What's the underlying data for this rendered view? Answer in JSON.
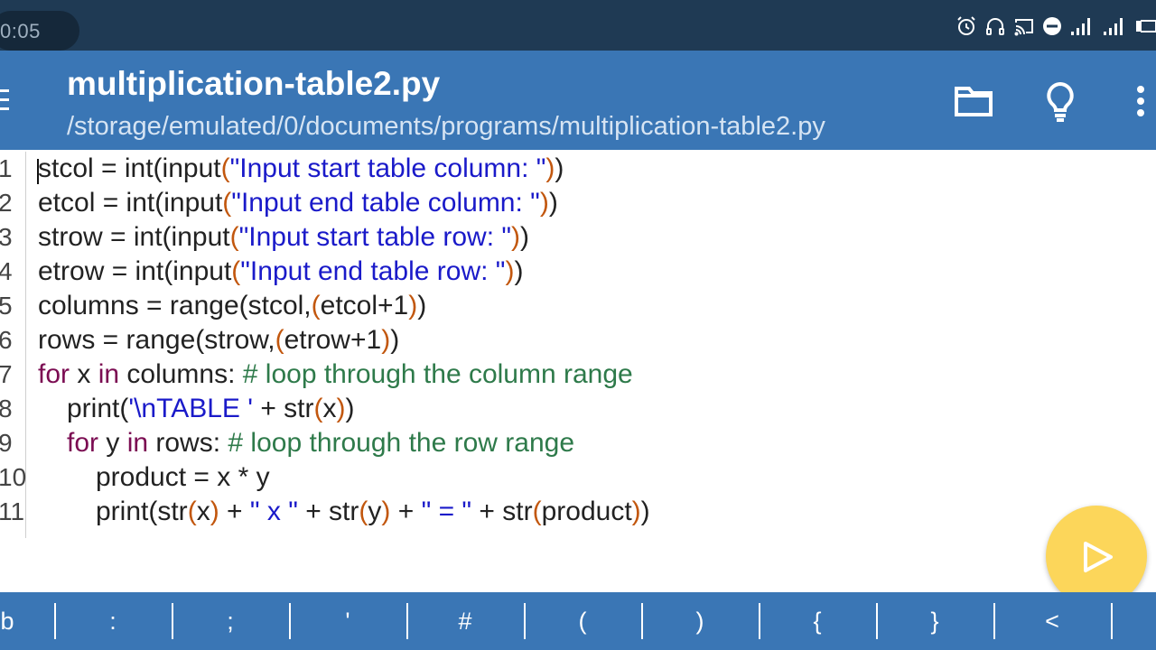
{
  "status_bar": {
    "time": "0:05",
    "icons": [
      "alarm-icon",
      "headphones-icon",
      "cast-icon",
      "dnd-icon",
      "signal-icon",
      "signal-icon",
      "battery-icon"
    ]
  },
  "app_bar": {
    "title": "multiplication-table2.py",
    "path": "/storage/emulated/0/documents/programs/multiplication-table2.py",
    "icons": [
      "menu-icon",
      "folder-icon",
      "lightbulb-icon",
      "more-vert-icon"
    ]
  },
  "editor": {
    "lines": [
      {
        "num": "1",
        "indent": 0,
        "tokens": [
          [
            "t",
            "stcol = int(input"
          ],
          [
            "p",
            "("
          ],
          [
            "s",
            "\"Input start table column: \""
          ],
          [
            "p",
            ")"
          ],
          [
            "t",
            ")"
          ]
        ]
      },
      {
        "num": "2",
        "indent": 0,
        "tokens": [
          [
            "t",
            "etcol = int(input"
          ],
          [
            "p",
            "("
          ],
          [
            "s",
            "\"Input end table column: \""
          ],
          [
            "p",
            ")"
          ],
          [
            "t",
            ")"
          ]
        ]
      },
      {
        "num": "3",
        "indent": 0,
        "tokens": [
          [
            "t",
            "strow = int(input"
          ],
          [
            "p",
            "("
          ],
          [
            "s",
            "\"Input start table row: \""
          ],
          [
            "p",
            ")"
          ],
          [
            "t",
            ")"
          ]
        ]
      },
      {
        "num": "4",
        "indent": 0,
        "tokens": [
          [
            "t",
            "etrow = int(input"
          ],
          [
            "p",
            "("
          ],
          [
            "s",
            "\"Input end table row: \""
          ],
          [
            "p",
            ")"
          ],
          [
            "t",
            ")"
          ]
        ]
      },
      {
        "num": "5",
        "indent": 0,
        "tokens": [
          [
            "t",
            "columns = range(stcol,"
          ],
          [
            "p",
            "("
          ],
          [
            "t",
            "etcol+1"
          ],
          [
            "p",
            ")"
          ],
          [
            "t",
            ")"
          ]
        ]
      },
      {
        "num": "6",
        "indent": 0,
        "tokens": [
          [
            "t",
            "rows = range(strow,"
          ],
          [
            "p",
            "("
          ],
          [
            "t",
            "etrow+1"
          ],
          [
            "p",
            ")"
          ],
          [
            "t",
            ")"
          ]
        ]
      },
      {
        "num": "7",
        "indent": 0,
        "tokens": [
          [
            "k",
            "for"
          ],
          [
            "t",
            " x "
          ],
          [
            "k",
            "in"
          ],
          [
            "t",
            " columns: "
          ],
          [
            "c",
            "# loop through the column range"
          ]
        ]
      },
      {
        "num": "8",
        "indent": 1,
        "tokens": [
          [
            "t",
            "print("
          ],
          [
            "s",
            "'\\nTABLE '"
          ],
          [
            "t",
            " + str"
          ],
          [
            "p",
            "("
          ],
          [
            "t",
            "x"
          ],
          [
            "p",
            ")"
          ],
          [
            "t",
            ")"
          ]
        ]
      },
      {
        "num": "9",
        "indent": 1,
        "tokens": [
          [
            "k",
            "for"
          ],
          [
            "t",
            " y "
          ],
          [
            "k",
            "in"
          ],
          [
            "t",
            " rows: "
          ],
          [
            "c",
            "# loop through the row range"
          ]
        ]
      },
      {
        "num": "10",
        "indent": 2,
        "tokens": [
          [
            "t",
            "product = x * y"
          ]
        ]
      },
      {
        "num": "11",
        "indent": 2,
        "tokens": [
          [
            "t",
            "print(str"
          ],
          [
            "p",
            "("
          ],
          [
            "t",
            "x"
          ],
          [
            "p",
            ")"
          ],
          [
            "t",
            " + "
          ],
          [
            "s",
            "\" x \""
          ],
          [
            "t",
            " + str"
          ],
          [
            "p",
            "("
          ],
          [
            "t",
            "y"
          ],
          [
            "p",
            ")"
          ],
          [
            "t",
            " + "
          ],
          [
            "s",
            "\" = \""
          ],
          [
            "t",
            " + str"
          ],
          [
            "p",
            "("
          ],
          [
            "t",
            "product"
          ],
          [
            "p",
            ")"
          ],
          [
            "t",
            ")"
          ]
        ]
      }
    ]
  },
  "run_button": {
    "icon": "play-icon"
  },
  "symbol_bar": {
    "keys": [
      "tab",
      ":",
      ";",
      "'",
      "#",
      "(",
      ")",
      "{",
      "}",
      "<"
    ]
  },
  "colors": {
    "status_bar": "#1f3a54",
    "app_bar": "#3a76b5",
    "keyword": "#7b0c52",
    "string": "#1a1ac9",
    "comment": "#2e7a4a",
    "paren": "#c2570e",
    "run_button": "#fcd65a"
  }
}
